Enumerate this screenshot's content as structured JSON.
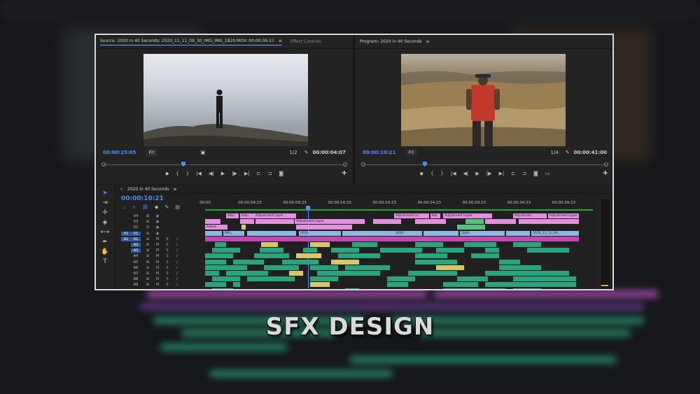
{
  "source_monitor": {
    "tab_label": "Source: 2020 in 40 Seconds: 2020_11_11_09_30_IMG_IMG_1820.MOV: 00:00:36:17",
    "menu_icon": "≡",
    "effect_controls_tab": "Effect Controls",
    "timecode_left": "00:00:25:05",
    "zoom": "Fit",
    "resolution": "1/2",
    "timecode_right": "00:00:04:07"
  },
  "program_monitor": {
    "tab_label": "Program: 2020 in 40 Seconds",
    "menu_icon": "≡",
    "timecode_left": "00:00:10:21",
    "zoom": "Fit",
    "resolution": "1/4",
    "timecode_right": "00:00:41:00"
  },
  "timeline": {
    "sequence_tab": "2020 in 40 Seconds",
    "menu_icon": "≡",
    "playhead_timecode": "00:00:10:21",
    "ruler": [
      "00:00",
      "00:00:04:23",
      "00:00:09:23",
      "00:00:14:23",
      "00:00:19:23",
      "00:00:24:23",
      "00:00:29:23",
      "00:00:34:23",
      "00:00:39:23"
    ],
    "playhead_fraction": 0.265,
    "video_tracks": [
      {
        "name": "V4"
      },
      {
        "name": "V3"
      },
      {
        "name": "V2"
      },
      {
        "source": "V1",
        "name": "V1"
      }
    ],
    "audio_tracks": [
      {
        "source": "A1",
        "name": "A1",
        "m": "M",
        "s": "S"
      },
      {
        "name": "A2",
        "m": "M",
        "s": "S"
      },
      {
        "name": "A3",
        "m": "M",
        "s": "S"
      },
      {
        "name": "A4",
        "m": "M",
        "s": "S"
      },
      {
        "name": "A5",
        "m": "M",
        "s": "S"
      },
      {
        "name": "A6",
        "m": "M",
        "s": "S"
      },
      {
        "name": "A7",
        "m": "M",
        "s": "S"
      },
      {
        "name": "A8",
        "m": "M",
        "s": "S"
      },
      {
        "name": "A9",
        "m": "M",
        "s": "S"
      }
    ],
    "clip_labels": {
      "adjustment": "Adjustment Layer",
      "adjust_short": "Adjust",
      "adjustmen": "Adjustmen",
      "adjustment_la": "Adjustment La",
      "adjust_tiny": "Adju",
      "adj": "Adj",
      "img": "IMG_",
      "year": "2020",
      "file": "2020_11_11_09_"
    }
  },
  "title_overlay": "SFX DESIGN",
  "colors": {
    "accent_blue": "#4d8ef6",
    "adjustment_clip": "#e28fe0",
    "video_clip": "#8fb6e3",
    "audio_clip": "#2ca37c",
    "yellow_clip": "#d7c66a"
  }
}
